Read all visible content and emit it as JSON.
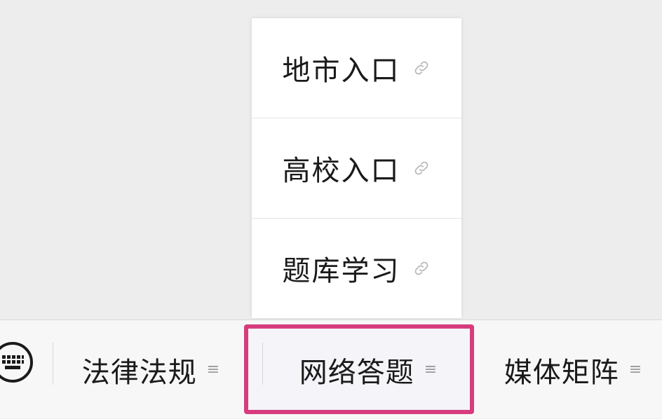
{
  "submenu": {
    "items": [
      {
        "label": "地市入口",
        "icon": "link-icon"
      },
      {
        "label": "高校入口",
        "icon": "link-icon"
      },
      {
        "label": "题库学习",
        "icon": "link-icon"
      }
    ]
  },
  "bottombar": {
    "keyboard_icon": "keyboard-icon",
    "menus": [
      {
        "label": "法律法规",
        "glyph": "≡"
      },
      {
        "label": "网络答题",
        "glyph": "≡",
        "highlighted": true
      },
      {
        "label": "媒体矩阵",
        "glyph": "≡"
      }
    ]
  },
  "colors": {
    "highlight_border": "#d63c7e",
    "background": "#ededed"
  }
}
